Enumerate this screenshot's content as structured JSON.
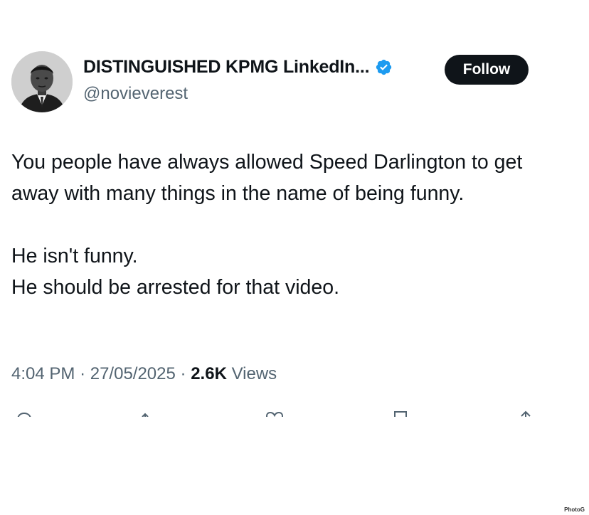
{
  "author": {
    "display_name": "DISTINGUISHED KPMG LinkedIn...",
    "handle": "@novieverest",
    "verified": true,
    "avatar_icon": "profile-photo"
  },
  "follow_button": {
    "label": "Follow"
  },
  "tweet": {
    "paragraph1": "You people have always allowed Speed Darlington to get away with many things in the name of being funny.",
    "line2": "He isn't funny.",
    "line3": "He should be arrested for that video."
  },
  "meta": {
    "time": "4:04 PM",
    "date": "27/05/2025",
    "separator": "·",
    "views_count": "2.6K",
    "views_label": "Views"
  },
  "actions": [
    "reply-icon",
    "retweet-icon",
    "like-icon",
    "bookmark-icon",
    "share-icon"
  ],
  "watermark": "PhotoG",
  "colors": {
    "text": "#0f1419",
    "secondary": "#536471",
    "verified": "#1d9bf0",
    "follow_bg": "#0f1419"
  }
}
